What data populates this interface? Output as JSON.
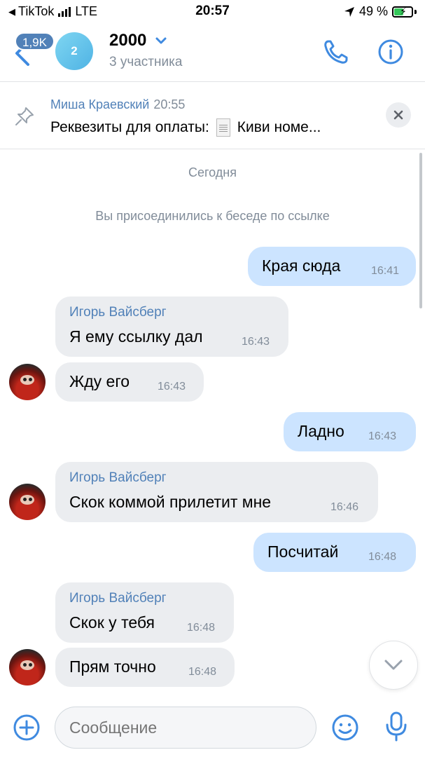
{
  "status_bar": {
    "app_back_label": "TikTok",
    "network": "LTE",
    "time": "20:57",
    "battery": "49 %",
    "battery_level": 0.49
  },
  "header": {
    "unread_count": "1,9K",
    "avatar_label": "2",
    "title": "2000",
    "subtitle": "3 участника"
  },
  "pinned": {
    "author": "Миша Краевский",
    "time": "20:55",
    "text_before": "Реквезиты для оплаты:",
    "text_after": "Киви номе..."
  },
  "chat": {
    "date_separator": "Сегодня",
    "system_message": "Вы присоединились к беседе по ссылке",
    "messages": [
      {
        "direction": "out",
        "text": "Края сюда",
        "time": "16:41"
      },
      {
        "direction": "in",
        "author": "Игорь Вайсберг",
        "text": "Я ему ссылку дал",
        "time": "16:43"
      },
      {
        "direction": "in",
        "text": "Жду его",
        "time": "16:43"
      },
      {
        "direction": "out",
        "text": "Ладно",
        "time": "16:43"
      },
      {
        "direction": "in",
        "author": "Игорь Вайсберг",
        "text": "Скок коммой прилетит мне",
        "time": "16:46"
      },
      {
        "direction": "out",
        "text": "Посчитай",
        "time": "16:48"
      },
      {
        "direction": "in",
        "author": "Игорь Вайсберг",
        "text": "Скок у тебя",
        "time": "16:48"
      },
      {
        "direction": "in",
        "text": "Прям точно",
        "time": "16:48"
      }
    ]
  },
  "composer": {
    "placeholder": "Сообщение"
  },
  "colors": {
    "accent": "#5181b8",
    "outgoing_bubble": "#cce4ff",
    "incoming_bubble": "#ebedf0",
    "secondary_text": "#818c99",
    "icon_blue": "#3f8ae0"
  },
  "icons": [
    "back-icon",
    "chevron-down-icon",
    "phone-icon",
    "info-icon",
    "pin-icon",
    "close-icon",
    "chevron-down-icon",
    "plus-icon",
    "emoji-icon",
    "microphone-icon"
  ]
}
